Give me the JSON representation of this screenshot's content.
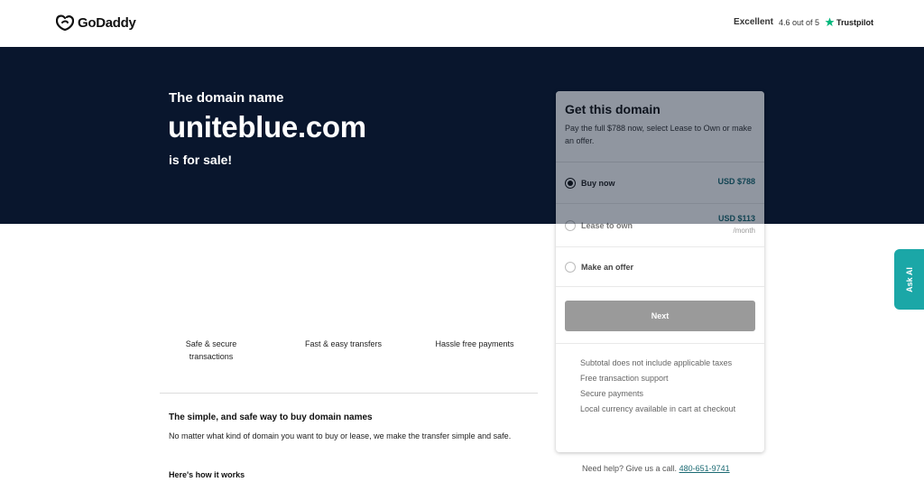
{
  "header": {
    "logo_text": "GoDaddy",
    "trust_excellent": "Excellent",
    "trust_rating": "4.6 out of 5",
    "trust_brand": "Trustpilot",
    "trust_color": "#00b67a"
  },
  "hero": {
    "pre_text": "The domain name",
    "domain": "uniteblue.com",
    "post_text": "is for sale!",
    "background": "#09162d"
  },
  "card": {
    "title": "Get this domain",
    "subtitle": "Pay the full $788 now, select Lease to Own or make an offer.",
    "options": [
      {
        "label": "Buy now",
        "price": "USD $788",
        "selected": true
      },
      {
        "label": "Lease to own",
        "price": "USD $113",
        "per": "/month",
        "selected": false
      },
      {
        "label": "Make an offer",
        "selected": false
      }
    ],
    "next_label": "Next",
    "bullets": [
      "Subtotal does not include applicable taxes",
      "Free transaction support",
      "Secure payments",
      "Local currency available in cart at checkout"
    ]
  },
  "help": {
    "text": "Need help? Give us a call.",
    "phone": "480-651-9741"
  },
  "features": [
    "Safe & secure transactions",
    "Fast & easy transfers",
    "Hassle free payments"
  ],
  "info": {
    "title": "The simple, and safe way to buy domain names",
    "body": "No matter what kind of domain you want to buy or lease, we make the transfer simple and safe.",
    "how_title": "Here's how it works"
  },
  "ask_ai": {
    "label": "Ask AI",
    "color": "#1ba7a7"
  }
}
